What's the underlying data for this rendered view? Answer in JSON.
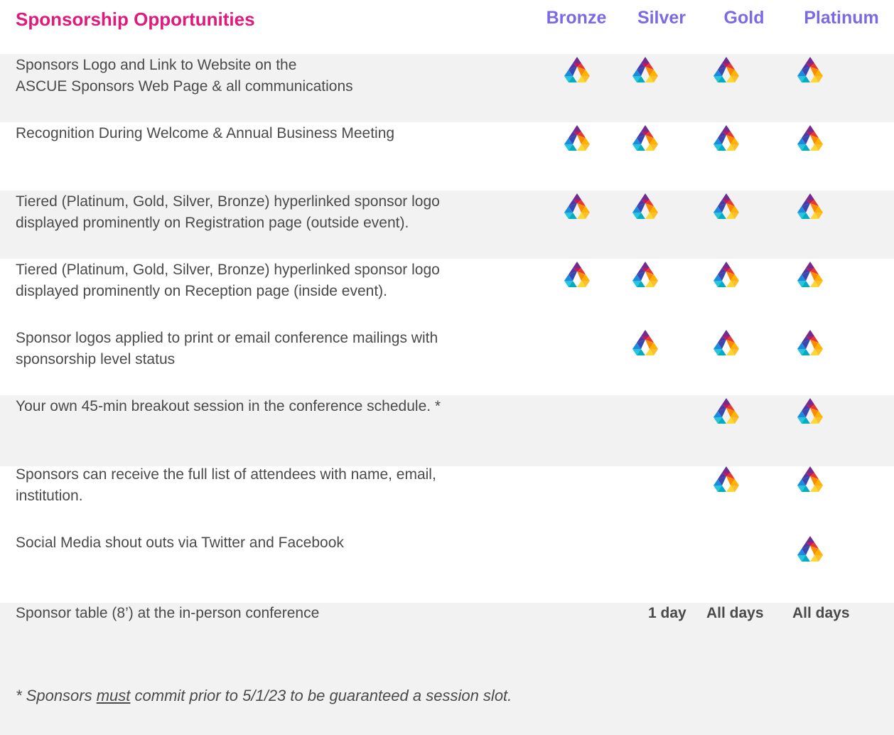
{
  "header": {
    "title": "Sponsorship Opportunities",
    "tiers": [
      "Bronze",
      "Silver",
      "Gold",
      "Platinum"
    ]
  },
  "colors": {
    "title": "#e0197d",
    "tier": "#7b6ae6",
    "row_shade": "#f2f2f2",
    "text": "#4a4a4a"
  },
  "logo_icon": "ascue-triangle-logo-icon",
  "rows": [
    {
      "lines": "Sponsors Logo and Link to Website on the\nASCUE Sponsors Web Page & all communications",
      "tiers": [
        true,
        true,
        true,
        true
      ]
    },
    {
      "lines": "Recognition During Welcome & Annual Business Meeting",
      "tiers": [
        true,
        true,
        true,
        true
      ]
    },
    {
      "lines": "Tiered (Platinum, Gold, Silver, Bronze) hyperlinked sponsor logo\ndisplayed prominently on Registration page (outside event).",
      "tiers": [
        true,
        true,
        true,
        true
      ]
    },
    {
      "lines": "Tiered (Platinum, Gold, Silver, Bronze) hyperlinked sponsor logo\ndisplayed prominently on Reception page (inside event).",
      "tiers": [
        true,
        true,
        true,
        true
      ]
    },
    {
      "lines": "Sponsor logos applied to print or email conference mailings with\nsponsorship level status",
      "tiers": [
        false,
        true,
        true,
        true
      ]
    },
    {
      "lines": "Your own 45-min breakout session in the conference schedule. *",
      "tiers": [
        false,
        false,
        true,
        true
      ]
    },
    {
      "lines": "Sponsors can receive the full list of attendees with name, email,\ninstitution.",
      "tiers": [
        false,
        false,
        true,
        true
      ]
    },
    {
      "lines": "Social Media shout outs via Twitter and Facebook",
      "tiers": [
        false,
        false,
        false,
        true
      ]
    }
  ],
  "table_row": {
    "label": "Sponsor table (8’) at the in-person conference",
    "silver": "1 day",
    "gold": "All days",
    "platinum": "All days"
  },
  "footnote": {
    "prefix": "*  Sponsors ",
    "emphasis": "must",
    "suffix": " commit prior to 5/1/23 to be guaranteed a session slot."
  }
}
